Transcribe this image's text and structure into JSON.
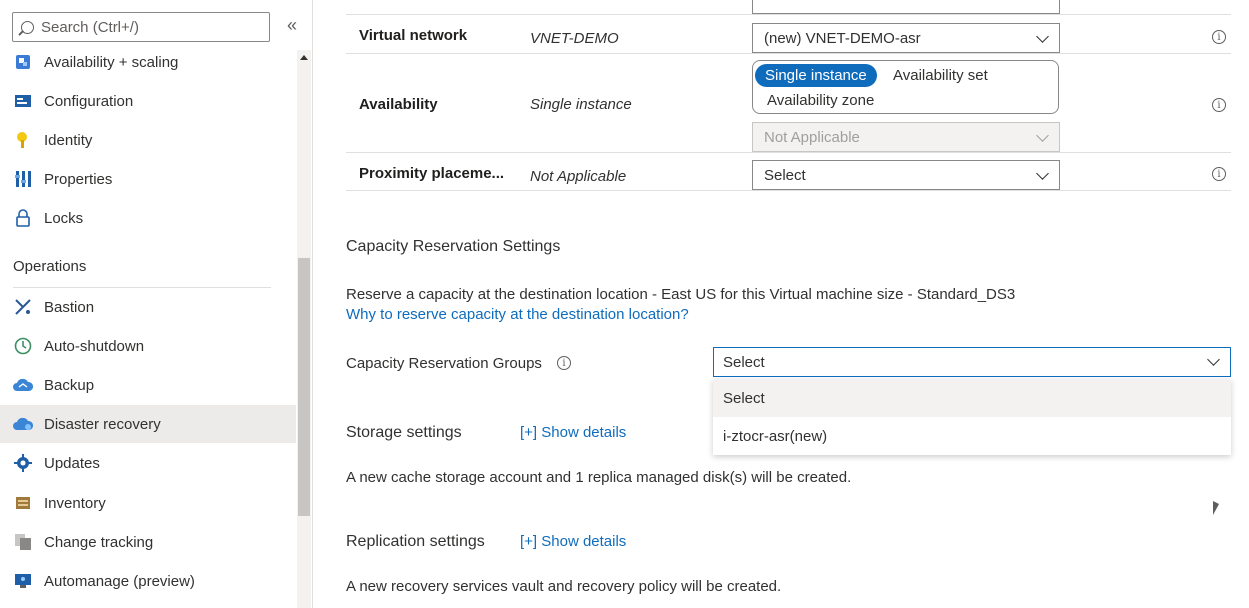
{
  "sidebar": {
    "search_placeholder": "Search (Ctrl+/)",
    "collapse_label": "«",
    "items_top": [
      {
        "label": "Availability + scaling",
        "icon": "availability-icon"
      },
      {
        "label": "Configuration",
        "icon": "configuration-icon"
      },
      {
        "label": "Identity",
        "icon": "identity-icon"
      },
      {
        "label": "Properties",
        "icon": "properties-icon"
      },
      {
        "label": "Locks",
        "icon": "lock-icon"
      }
    ],
    "section_title": "Operations",
    "items_ops": [
      {
        "label": "Bastion",
        "icon": "bastion-icon"
      },
      {
        "label": "Auto-shutdown",
        "icon": "clock-icon"
      },
      {
        "label": "Backup",
        "icon": "backup-cloud-icon"
      },
      {
        "label": "Disaster recovery",
        "icon": "disaster-recovery-cloud-icon",
        "active": true
      },
      {
        "label": "Updates",
        "icon": "gear-icon"
      },
      {
        "label": "Inventory",
        "icon": "inventory-icon"
      },
      {
        "label": "Change tracking",
        "icon": "change-tracking-icon"
      },
      {
        "label": "Automanage (preview)",
        "icon": "automanage-icon"
      }
    ]
  },
  "rows": {
    "vnet": {
      "label": "Virtual network",
      "value": "VNET-DEMO",
      "select": "(new) VNET-DEMO-asr"
    },
    "availability": {
      "label": "Availability",
      "value": "Single instance",
      "options": [
        "Single instance",
        "Availability set",
        "Availability zone"
      ],
      "selected": "Single instance",
      "sub_select": "Not Applicable"
    },
    "proximity": {
      "label": "Proximity placeme...",
      "value": "Not Applicable",
      "select": "Select"
    }
  },
  "capacity": {
    "heading": "Capacity Reservation Settings",
    "description": "Reserve a capacity at the destination location - East US for this Virtual machine size - Standard_DS3",
    "link": "Why to reserve capacity at the destination location?",
    "groups_label": "Capacity Reservation Groups",
    "select_value": "Select",
    "options": [
      "Select",
      "i-ztocr-asr(new)"
    ]
  },
  "storage": {
    "heading": "Storage settings",
    "link": "[+] Show details",
    "text": "A new cache storage account and 1 replica managed disk(s) will be created."
  },
  "replication": {
    "heading": "Replication settings",
    "link": "[+] Show details",
    "text": "A new recovery services vault and recovery policy will be created."
  },
  "info_glyph": "i",
  "colors": {
    "accent": "#0f6cbd",
    "active_bg": "#edebe9"
  }
}
